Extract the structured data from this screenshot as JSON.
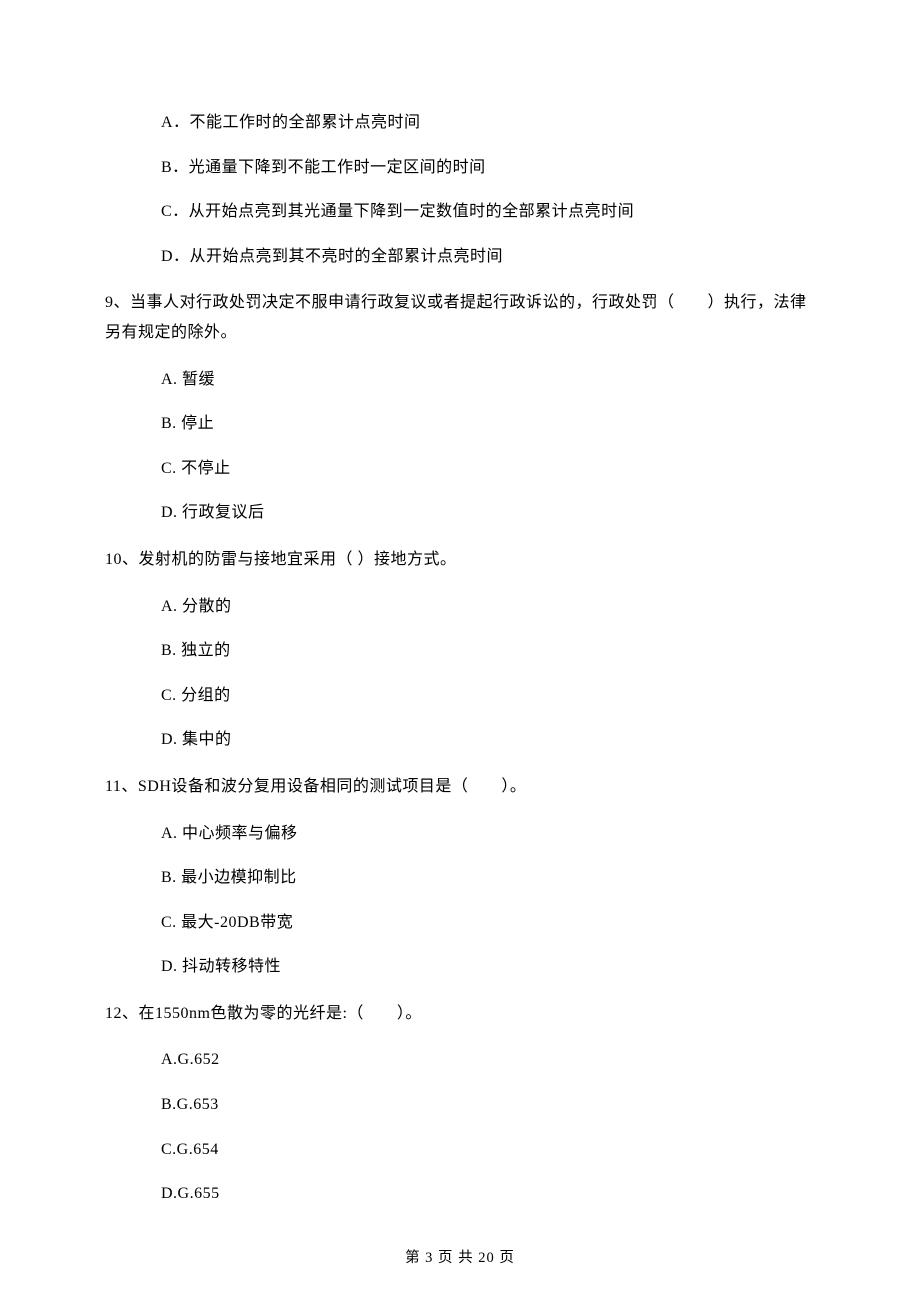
{
  "q8_options": {
    "a": "A．不能工作时的全部累计点亮时间",
    "b": "B．光通量下降到不能工作时一定区间的时间",
    "c": "C．从开始点亮到其光通量下降到一定数值时的全部累计点亮时间",
    "d": "D．从开始点亮到其不亮时的全部累计点亮时间"
  },
  "q9": {
    "text": "9、当事人对行政处罚决定不服申请行政复议或者提起行政诉讼的，行政处罚（　　）执行，法律另有规定的除外。",
    "a": "A. 暂缓",
    "b": "B. 停止",
    "c": "C. 不停止",
    "d": "D. 行政复议后"
  },
  "q10": {
    "text": "10、发射机的防雷与接地宜采用（    ）接地方式。",
    "a": "A. 分散的",
    "b": "B. 独立的",
    "c": "C. 分组的",
    "d": "D. 集中的"
  },
  "q11": {
    "text": "11、SDH设备和波分复用设备相同的测试项目是（　　）。",
    "a": "A. 中心频率与偏移",
    "b": "B. 最小边模抑制比",
    "c": "C. 最大-20DB带宽",
    "d": "D. 抖动转移特性"
  },
  "q12": {
    "text": "12、在1550nm色散为零的光纤是:（　　）。",
    "a": "A.G.652",
    "b": "B.G.653",
    "c": "C.G.654",
    "d": "D.G.655"
  },
  "footer": "第 3 页 共 20 页"
}
